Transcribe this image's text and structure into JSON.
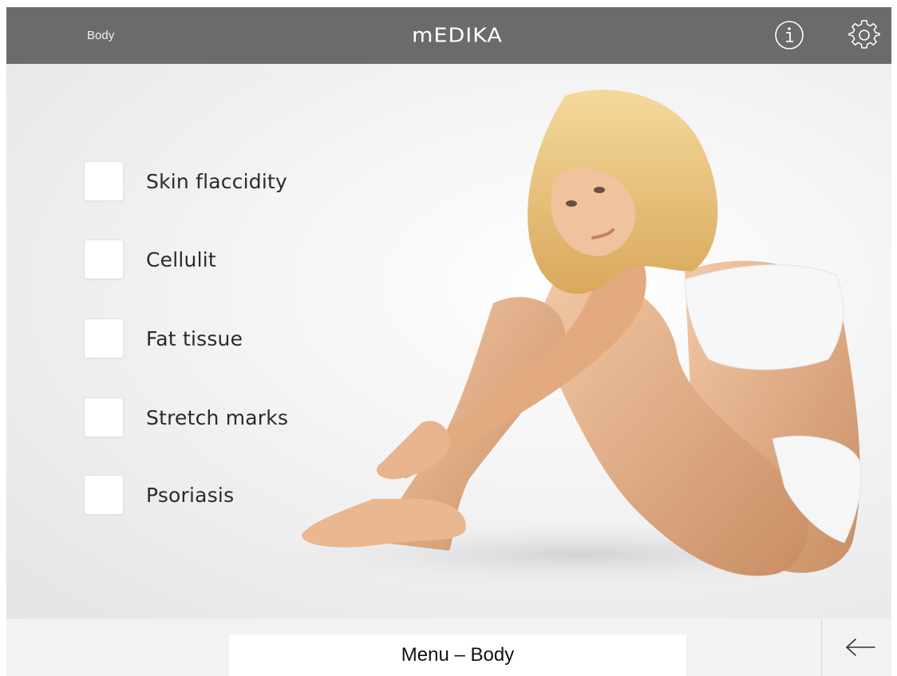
{
  "header": {
    "breadcrumb": "Body",
    "logo_text": "mEDIKA",
    "info_icon": "info-icon",
    "settings_icon": "gear-icon"
  },
  "options": [
    {
      "label": "Skin flaccidity",
      "checked": false
    },
    {
      "label": "Cellulit",
      "checked": false
    },
    {
      "label": "Fat tissue",
      "checked": false
    },
    {
      "label": "Stretch marks",
      "checked": false
    },
    {
      "label": "Psoriasis",
      "checked": false
    }
  ],
  "footer": {
    "title": "Menu – Body",
    "back_icon": "arrow-left-icon"
  },
  "colors": {
    "header_bg": "#6b6b6b",
    "footer_bg": "#f2f2f2",
    "text": "#2a2a2a"
  }
}
